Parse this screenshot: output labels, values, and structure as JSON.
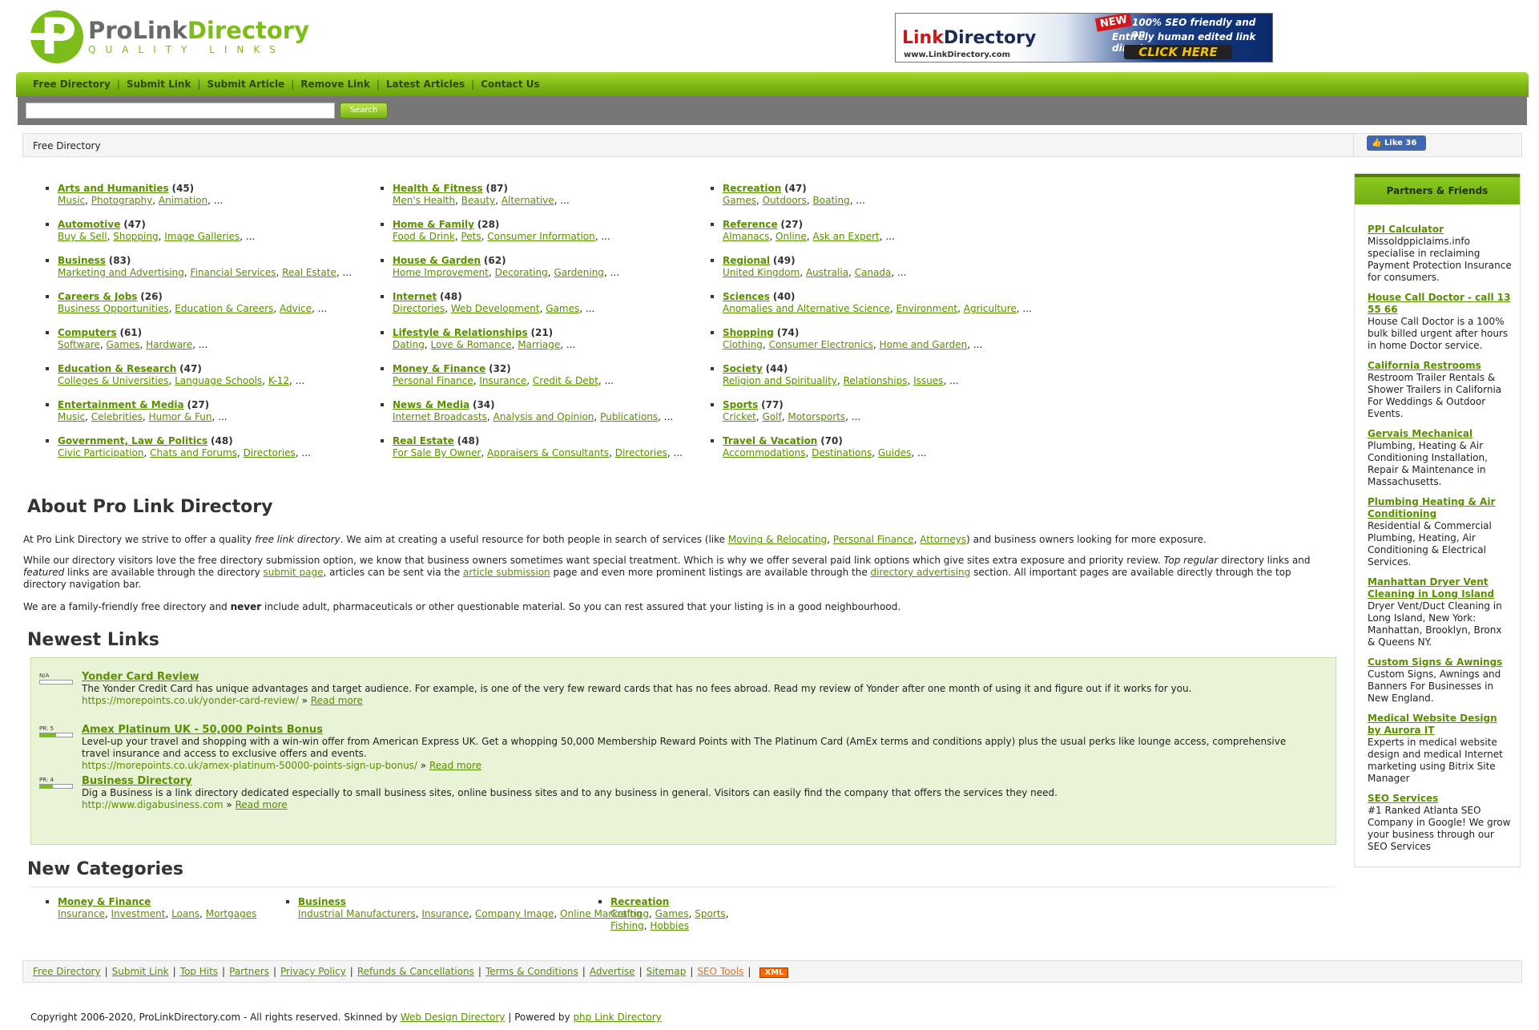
{
  "header": {
    "logo_main": "ProLink",
    "logo_dir": "Directory",
    "logo_sub": "QUALITY LINKS",
    "banner": {
      "brand_red": "Link",
      "brand_dark": "Directory",
      "url": "www.LinkDirectory.com",
      "badge": "NEW",
      "line1": "100% SEO friendly and an",
      "line2": "Entirely human edited link directory",
      "cta": "CLICK HERE"
    }
  },
  "nav": [
    "Free Directory",
    "Submit Link",
    "Submit Article",
    "Remove Link",
    "Latest Articles",
    "Contact Us"
  ],
  "search": {
    "button": "Search",
    "placeholder": ""
  },
  "breadcrumb": "Free Directory",
  "fb_like": "Like 36",
  "categories": [
    [
      {
        "name": "Arts and Humanities",
        "count": "(45)",
        "subs": [
          "Music",
          "Photography",
          "Animation"
        ]
      },
      {
        "name": "Automotive",
        "count": "(47)",
        "subs": [
          "Buy & Sell",
          "Shopping",
          "Image Galleries"
        ]
      },
      {
        "name": "Business",
        "count": "(83)",
        "subs": [
          "Marketing and Advertising",
          "Financial Services",
          "Real Estate"
        ]
      },
      {
        "name": "Careers & Jobs",
        "count": "(26)",
        "subs": [
          "Business Opportunities",
          "Education & Careers",
          "Advice"
        ]
      },
      {
        "name": "Computers",
        "count": "(61)",
        "subs": [
          "Software",
          "Games",
          "Hardware"
        ]
      },
      {
        "name": "Education & Research",
        "count": "(47)",
        "subs": [
          "Colleges & Universities",
          "Language Schools",
          "K-12"
        ]
      },
      {
        "name": "Entertainment & Media",
        "count": "(27)",
        "subs": [
          "Music",
          "Celebrities",
          "Humor & Fun"
        ]
      },
      {
        "name": "Government, Law & Politics",
        "count": "(48)",
        "subs": [
          "Civic Participation",
          "Chats and Forums",
          "Directories"
        ]
      }
    ],
    [
      {
        "name": "Health & Fitness",
        "count": "(87)",
        "subs": [
          "Men's Health",
          "Beauty",
          "Alternative"
        ]
      },
      {
        "name": "Home & Family",
        "count": "(28)",
        "subs": [
          "Food & Drink",
          "Pets",
          "Consumer Information"
        ]
      },
      {
        "name": "House & Garden",
        "count": "(62)",
        "subs": [
          "Home Improvement",
          "Decorating",
          "Gardening"
        ]
      },
      {
        "name": "Internet",
        "count": "(48)",
        "subs": [
          "Directories",
          "Web Development",
          "Games"
        ]
      },
      {
        "name": "Lifestyle & Relationships",
        "count": "(21)",
        "subs": [
          "Dating",
          "Love & Romance",
          "Marriage"
        ]
      },
      {
        "name": "Money & Finance",
        "count": "(32)",
        "subs": [
          "Personal Finance",
          "Insurance",
          "Credit & Debt"
        ]
      },
      {
        "name": "News & Media",
        "count": "(34)",
        "subs": [
          "Internet Broadcasts",
          "Analysis and Opinion",
          "Publications"
        ]
      },
      {
        "name": "Real Estate",
        "count": "(48)",
        "subs": [
          "For Sale By Owner",
          "Appraisers & Consultants",
          "Directories"
        ]
      }
    ],
    [
      {
        "name": "Recreation",
        "count": "(47)",
        "subs": [
          "Games",
          "Outdoors",
          "Boating"
        ]
      },
      {
        "name": "Reference",
        "count": "(27)",
        "subs": [
          "Almanacs",
          "Online",
          "Ask an Expert"
        ]
      },
      {
        "name": "Regional",
        "count": "(49)",
        "subs": [
          "United Kingdom",
          "Australia",
          "Canada"
        ]
      },
      {
        "name": "Sciences",
        "count": "(40)",
        "subs": [
          "Anomalies and Alternative Science",
          "Environment",
          "Agriculture"
        ]
      },
      {
        "name": "Shopping",
        "count": "(74)",
        "subs": [
          "Clothing",
          "Consumer Electronics",
          "Home and Garden"
        ]
      },
      {
        "name": "Society",
        "count": "(44)",
        "subs": [
          "Religion and Spirituality",
          "Relationships",
          "Issues"
        ]
      },
      {
        "name": "Sports",
        "count": "(77)",
        "subs": [
          "Cricket",
          "Golf",
          "Motorsports"
        ]
      },
      {
        "name": "Travel & Vacation",
        "count": "(70)",
        "subs": [
          "Accommodations",
          "Destinations",
          "Guides"
        ]
      }
    ]
  ],
  "about": {
    "heading": "About Pro Link Directory",
    "p1_a": "At Pro Link Directory we strive to offer a quality ",
    "p1_em": "free link directory",
    "p1_b": ". We aim at creating a useful resource for both people in search of services (like ",
    "p1_links": [
      "Moving & Relocating",
      "Personal Finance",
      "Attorneys"
    ],
    "p1_c": ") and business owners looking for more exposure.",
    "p2_a": "While our directory visitors love the free directory submission option, we know that business owners sometimes want special treatment. Which is why we offer several paid link options which give sites extra exposure and priority review. ",
    "p2_em1": "Top regular",
    "p2_b": " directory links and ",
    "p2_em2": "featured",
    "p2_c": " links are available through the directory ",
    "p2_link1": "submit page",
    "p2_d": ", articles can be sent via the ",
    "p2_link2": "article submission",
    "p2_e": " page and even more prominent listings are available through the ",
    "p2_link3": "directory advertising",
    "p2_f": " section. All important pages are available directly through the top directory navigation bar.",
    "p3_a": "We are a family-friendly free directory and ",
    "p3_strong": "never",
    "p3_b": " include adult, pharmaceuticals or other questionable material. So you can rest assured that your listing is in a good neighbourhood."
  },
  "newest": {
    "heading": "Newest Links",
    "read_more": "Read more",
    "items": [
      {
        "pr": "N/A",
        "pr_value": 0,
        "title": "Yonder Card Review",
        "desc": "The Yonder Credit Card has unique advantages and target audience. For example, is one of the very few reward cards that has no fees abroad. Read my review of Yonder after one month of using it and figure out if it works for you.",
        "url": "https://morepoints.co.uk/yonder-card-review/"
      },
      {
        "pr": "PR: 5",
        "pr_value": 5,
        "title": "Amex Platinum UK - 50,000 Points Bonus",
        "desc": "Level-up your travel and shopping with a win-win offer from American Express UK. Get a whopping 50,000 Membership Reward Points with The Platinum Card (AmEx terms and conditions apply) plus the usual perks like lounge access, comprehensive travel insurance and access to exclusive offers and events.",
        "url": "https://morepoints.co.uk/amex-platinum-50000-points-sign-up-bonus/"
      },
      {
        "pr": "PR: 4",
        "pr_value": 4,
        "title": "Business Directory",
        "desc": "Dig a Business is a link directory dedicated especially to small business sites, online business sites and to any business in general. Visitors can easily find the company that offers the services they need.",
        "url": "http://www.digabusiness.com"
      }
    ]
  },
  "new_categories": {
    "heading": "New Categories",
    "items": [
      {
        "name": "Money & Finance",
        "subs": [
          "Insurance",
          "Investment",
          "Loans",
          "Mortgages"
        ]
      },
      {
        "name": "Business",
        "subs": [
          "Industrial Manufacturers",
          "Insurance",
          "Company Image",
          "Online Marketing"
        ]
      },
      {
        "name": "Recreation",
        "subs": [
          "Crafting",
          "Games",
          "Sports",
          "Fishing",
          "Hobbies"
        ]
      }
    ]
  },
  "footer": {
    "links": [
      "Free Directory",
      "Submit Link",
      "Top Hits",
      "Partners",
      "Privacy Policy",
      "Refunds & Cancellations",
      "Terms & Conditions",
      "Advertise",
      "Sitemap"
    ],
    "seo_tools": "SEO Tools",
    "xml": "XML",
    "copyright_a": "Copyright 2006-2020, ProLinkDirectory.com - All rights reserved. Skinned by ",
    "skinned_by": "Web Design Directory",
    "copyright_b": " | Powered by ",
    "powered_by": "php Link Directory"
  },
  "sidebar": {
    "heading": "Partners & Friends",
    "items": [
      {
        "title": "PPI Calculator",
        "desc": "Missoldppiclaims.info specialise in reclaiming Payment Protection Insurance for consumers."
      },
      {
        "title": "House Call Doctor - call 13 55 66",
        "desc": "House Call Doctor is a 100% bulk billed urgent after hours in home Doctor service."
      },
      {
        "title": "California Restrooms",
        "desc": "Restroom Trailer Rentals & Shower Trailers in California For Weddings & Outdoor Events."
      },
      {
        "title": "Gervais Mechanical",
        "desc": "Plumbing, Heating & Air Conditioning Installation, Repair & Maintenance in Massachusetts."
      },
      {
        "title": "Plumbing Heating & Air Conditioning",
        "desc": "Residential & Commercial Plumbing, Heating, Air Conditioning & Electrical Services."
      },
      {
        "title": "Manhattan Dryer Vent Cleaning in Long Island",
        "desc": "Dryer Vent/Duct Cleaning in Long Island, New York: Manhattan, Brooklyn, Bronx & Queens NY."
      },
      {
        "title": "Custom Signs & Awnings",
        "desc": "Custom Signs, Awnings and Banners For Businesses in New England."
      },
      {
        "title": "Medical Website Design by Aurora IT",
        "desc": "Experts in medical website design and medical Internet marketing using Bitrix Site Manager"
      },
      {
        "title": "SEO Services",
        "desc": "#1 Ranked Atlanta SEO Company in Google! We grow your business through our SEO Services"
      }
    ]
  }
}
